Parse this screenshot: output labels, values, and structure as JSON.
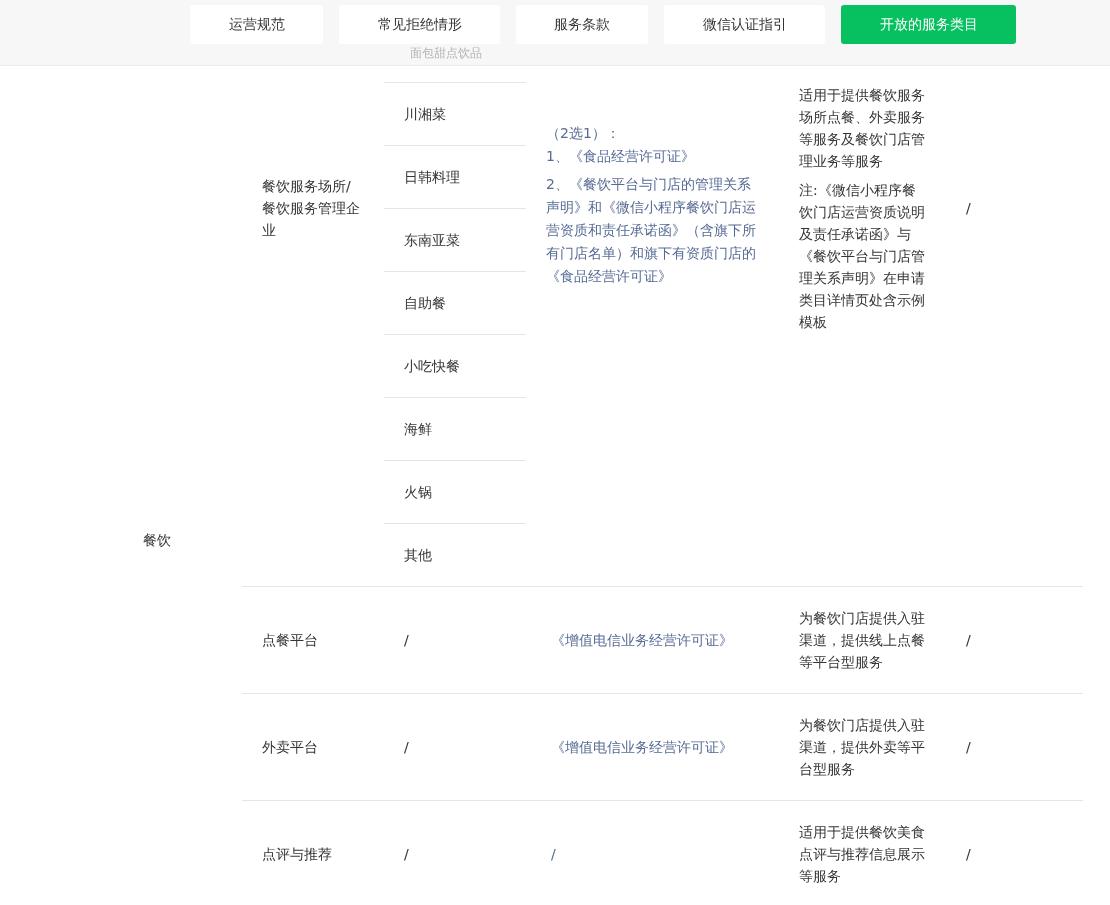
{
  "nav_tabs": [
    {
      "label": "运营规范",
      "selected": false
    },
    {
      "label": "常见拒绝情形",
      "selected": false
    },
    {
      "label": "服务条款",
      "selected": false
    },
    {
      "label": "微信认证指引",
      "selected": false
    },
    {
      "label": "开放的服务类目",
      "selected": true
    }
  ],
  "faded_text": "面包甜点饮品",
  "table": {
    "column_1": "餐饮",
    "rows": [
      {
        "kind": "list",
        "column_2": "餐饮服务场所/餐饮服务管理企业",
        "column_3": [
          "川湘菜",
          "日韩料理",
          "东南亚菜",
          "自助餐",
          "小吃快餐",
          "海鲜",
          "火锅",
          "其他"
        ],
        "column_4": [
          "（2选1）：\n1、《食品经营许可证》",
          "2、《餐饮平台与门店的管理关系声明》和《微信小程序餐饮门店运营资质和责任承诺函》（含旗下所有门店名单）和旗下有资质门店的《食品经营许可证》"
        ],
        "column_5": [
          "适用于提供餐饮服务场所点餐、外卖服务等服务及餐饮门店管理业务等服务",
          "注:《微信小程序餐饮门店运营资质说明及责任承诺函》与《餐饮平台与门店管理关系声明》在申请类目详情页处含示例模板"
        ],
        "column_6": "/"
      },
      {
        "kind": "plain",
        "column_2": "点餐平台",
        "column_3": [
          "/"
        ],
        "column_4": [
          "《增值电信业务经营许可证》"
        ],
        "column_5": [
          "为餐饮门店提供入驻渠道，提供线上点餐等平台型服务"
        ],
        "column_6": "/"
      },
      {
        "kind": "plain",
        "column_2": "外卖平台",
        "column_3": [
          "/"
        ],
        "column_4": [
          "《增值电信业务经营许可证》"
        ],
        "column_5": [
          "为餐饮门店提供入驻渠道，提供外卖等平台型服务"
        ],
        "column_6": "/"
      },
      {
        "kind": "plain",
        "column_2": "点评与推荐",
        "column_3": [
          "/"
        ],
        "column_4": [
          "/"
        ],
        "column_5": [
          "适用于提供餐饮美食点评与推荐信息展示等服务"
        ],
        "column_6": "/"
      }
    ]
  }
}
